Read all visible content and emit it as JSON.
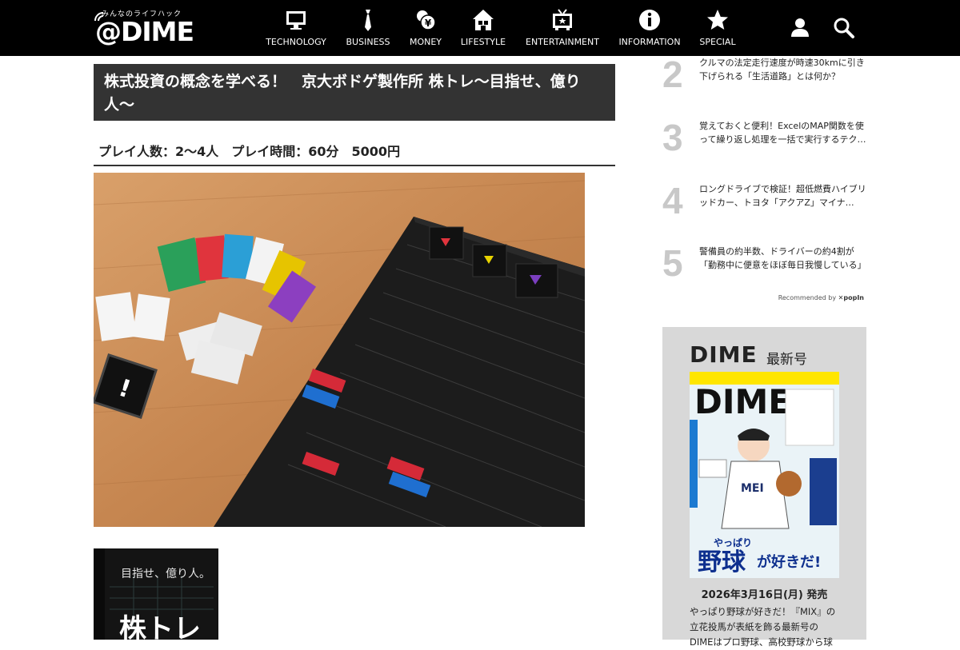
{
  "header": {
    "logo_tagline": "みんなのライフハック",
    "logo_text": "@DIME",
    "nav": [
      {
        "label": "TECHNOLOGY",
        "icon": "monitor-icon"
      },
      {
        "label": "BUSINESS",
        "icon": "necktie-icon"
      },
      {
        "label": "MONEY",
        "icon": "coin-yen-icon"
      },
      {
        "label": "LIFESTYLE",
        "icon": "house-icon"
      },
      {
        "label": "ENTERTAINMENT",
        "icon": "tv-icon"
      },
      {
        "label": "INFORMATION",
        "icon": "info-icon"
      },
      {
        "label": "SPECIAL",
        "icon": "star-icon"
      }
    ]
  },
  "article": {
    "title": "株式投資の概念を学べる！　京大ボドゲ製作所 株トレ〜目指せ、億り人〜",
    "subhead": "プレイ人数：2〜4人　プレイ時間：60分　5000円",
    "box_copy": "目指せ、億り人。",
    "box_title": "株トレ"
  },
  "ranking": [
    {
      "num": "2",
      "text": "クルマの法定走行速度が時速30kmに引き下げられる「生活道路」とは何か？"
    },
    {
      "num": "3",
      "text": "覚えておくと便利！ExcelのMAP関数を使って繰り返し処理を一括で実行するテク…"
    },
    {
      "num": "4",
      "text": "ロングドライブで検証！超低燃費ハイブリッドカー、トヨタ「アクアZ」マイナ…"
    },
    {
      "num": "5",
      "text": "警備員の約半数、ドライバーの約4割が「勤務中に便意をほぼ毎日我慢している」"
    }
  ],
  "recommend": "Recommended by",
  "recommend_brand": "popIn",
  "magazine": {
    "brand": "DIME",
    "latest": "最新号",
    "cover_title": "DIME",
    "cover_copy1": "やっぱり",
    "cover_copy2": "野球",
    "cover_copy3": "が好きだ!",
    "release": "2026年3月16日(月) 発売",
    "description": "やっぱり野球が好きだ！『MIX』の立花投馬が表紙を飾る最新号のDIMEはプロ野球、高校野球から球"
  },
  "colors": {
    "header_bg": "#000000",
    "title_bg": "#333333",
    "rank_num": "#c8c8c8",
    "magazine_bg": "#d8d8d8"
  }
}
